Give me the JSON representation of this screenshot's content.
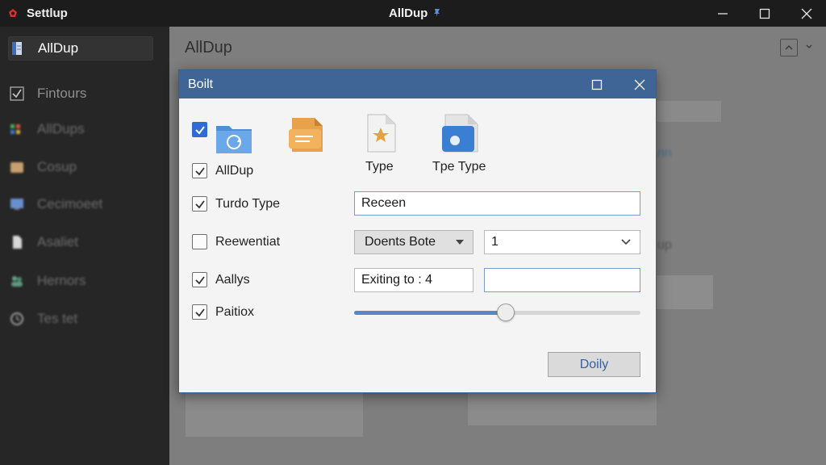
{
  "titlebar": {
    "app_name": "Settlup",
    "window_title": "AllDup",
    "logo_color": "#d9302c",
    "title_icon": "pin-icon"
  },
  "sidebar": {
    "items": [
      {
        "label": "AllDup",
        "icon": "document-icon",
        "active": true
      },
      {
        "label": "Fintours",
        "icon": "checkbox-icon"
      },
      {
        "label": "AllDups",
        "icon": "grid-icon"
      },
      {
        "label": "Cosup",
        "icon": "box-icon"
      },
      {
        "label": "Cecimoeet",
        "icon": "monitor-icon"
      },
      {
        "label": "Asaliet",
        "icon": "file-icon"
      },
      {
        "label": "Hernors",
        "icon": "people-icon"
      },
      {
        "label": "Tes tet",
        "icon": "clock-icon"
      }
    ]
  },
  "main": {
    "title": "AllDup",
    "bg_hint_right": "nn",
    "bg_hint_mid": "up"
  },
  "dialog": {
    "title": "Boilt",
    "header_color": "#3f6496",
    "icon_captions": {
      "type": "Type",
      "tpe_type": "Tpe Type"
    },
    "rows": [
      {
        "label": "AllDup",
        "checked": true
      },
      {
        "label": "Turdo Type",
        "checked": true
      },
      {
        "label": "Reewentiat",
        "checked": false
      },
      {
        "label": "Aallys",
        "checked": true
      },
      {
        "label": "Paitiox",
        "checked": true
      }
    ],
    "text_field_value": "Receen",
    "combo_value": "Doents Bote",
    "number_select_value": "1",
    "exiting_field_value": "Exiting to : 4",
    "empty_field_value": "",
    "slider_value_fraction": 0.53,
    "main_button_label": "Doily"
  }
}
